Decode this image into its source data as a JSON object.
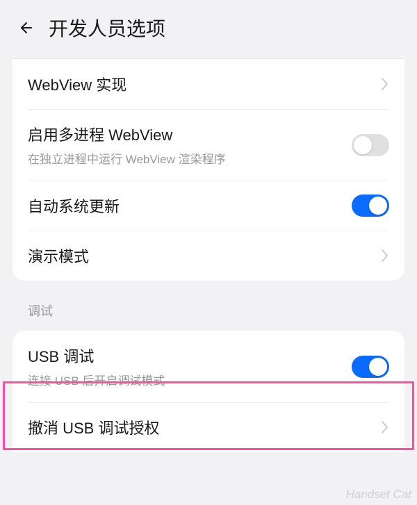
{
  "header": {
    "title": "开发人员选项"
  },
  "group1": {
    "items": [
      {
        "title": "WebView 实现",
        "type": "chevron"
      },
      {
        "title": "启用多进程 WebView",
        "subtitle": "在独立进程中运行 WebView 渲染程序",
        "type": "toggle",
        "on": false
      },
      {
        "title": "自动系统更新",
        "type": "toggle",
        "on": true
      },
      {
        "title": "演示模式",
        "type": "chevron"
      }
    ]
  },
  "section_debug": {
    "label": "调试"
  },
  "group2": {
    "items": [
      {
        "title": "USB 调试",
        "subtitle": "连接 USB 后开启调试模式",
        "type": "toggle",
        "on": true
      },
      {
        "title": "撤消 USB 调试授权",
        "type": "chevron"
      }
    ]
  },
  "watermark": "Handset Cat"
}
